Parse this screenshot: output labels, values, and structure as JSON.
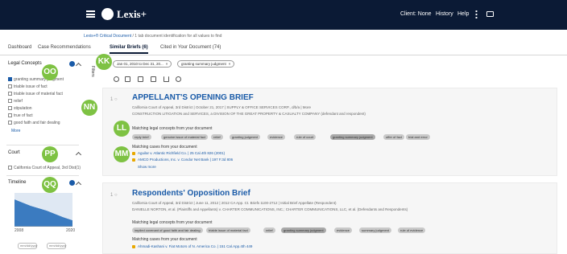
{
  "topbar": {
    "brand": "Lexis+",
    "links": [
      "Client: None",
      "History",
      "Help"
    ]
  },
  "breadcrumb": {
    "root": "Lexis+® Critical Document",
    "rest": "/ 1 tab document identification for all values to find"
  },
  "tabs": [
    {
      "label": "Dashboard",
      "active": false
    },
    {
      "label": "Case Recommendations",
      "active": false
    },
    {
      "label": "Similar Briefs (6)",
      "active": true
    },
    {
      "label": "Cited in Your Document (74)",
      "active": false
    }
  ],
  "sidebar": {
    "legal_concepts": {
      "title": "Legal Concepts",
      "options": [
        {
          "label": "granting summary judgment",
          "checked": true
        },
        {
          "label": "triable issue of fact",
          "checked": false
        },
        {
          "label": "triable issue of material fact",
          "checked": false
        },
        {
          "label": "relief",
          "checked": false
        },
        {
          "label": "stipulation",
          "checked": false
        },
        {
          "label": "true of fact",
          "checked": false
        },
        {
          "label": "good faith and fair dealing",
          "checked": false
        }
      ],
      "more": "More"
    },
    "court": {
      "title": "Court",
      "options": [
        {
          "label": "California Court of Appeal, 3rd Dist(1)",
          "checked": false
        }
      ]
    },
    "timeline": {
      "title": "Timeline",
      "x_start": "2008",
      "x_end": "2020",
      "from": "mm/dd/yyyy",
      "to": "mm/dd/yyyy"
    }
  },
  "filters_label": "Filters",
  "chips": [
    {
      "label": "Jan 01, 2010 to Dec 31, 20..."
    },
    {
      "label": "granting summary judgment"
    }
  ],
  "markers": [
    "KK",
    "OO",
    "NN",
    "LL",
    "MM",
    "PP",
    "QQ"
  ],
  "results": [
    {
      "num": "1 ○",
      "title": "APPELLANT'S OPENING BRIEF",
      "meta1": "California Court of Appeal, 3rd District  |  October 21, 2017  |  SUPPLY & OFFICE SERVICES CORP., d/b/a  |  More",
      "meta2": "CONSTRUCTION LITIGATION and SERVICES, a DIVISION OF THE GREAT PROPERTY & CASUALTY COMPANY (defendant and respondent)",
      "concepts_title": "Matching legal concepts from your document",
      "concepts": [
        {
          "label": "reply brief",
          "hl": false
        },
        {
          "label": "genuine issue of material fact",
          "hl": false
        },
        {
          "label": "relief",
          "hl": false
        },
        {
          "label": "granting judgment",
          "hl": false
        },
        {
          "label": "evidence",
          "hl": false
        },
        {
          "label": "rule of court",
          "hl": false
        },
        {
          "label": "granting summary judgment",
          "hl": true
        },
        {
          "label": "offer of fact",
          "hl": false
        },
        {
          "label": "trial and error",
          "hl": false
        }
      ],
      "cases_title": "Matching cases from your document",
      "cases": [
        "Aguilar v. Atlantic Richfield Co.  |  25 Cal.4th 826 (2001)",
        "AMCO Productions, Inc. v. Condor Net Bank  |  197 F.3d 806"
      ],
      "show_more": "Show more"
    },
    {
      "num": "1 ○",
      "title": "Respondents' Opposition Brief",
      "meta1": "California Court of Appeal, 3rd District  |  June 11, 2012  |  2012 CA App. Ct. Briefs 1100-2712  |  Initial Brief Appellate (Respondent)",
      "meta2": "DANIELLE NORTON, et al. (Plaintiffs and Appellants) v. CHARTER COMMUNICATIONS, INC.; CHARTER COMMUNICATIONS, LLC, et al. (Defendants and Respondents)",
      "concepts_title": "Matching legal concepts from your document",
      "concepts": [
        {
          "label": "implied covenant of good faith and fair dealing",
          "hl": false
        },
        {
          "label": "triable issue of material fact",
          "hl": false
        },
        {
          "label": "relief",
          "hl": false
        },
        {
          "label": "granting summary judgment",
          "hl": true
        },
        {
          "label": "evidence",
          "hl": false
        },
        {
          "label": "summary judgment",
          "hl": false
        },
        {
          "label": "rule of evidence",
          "hl": false
        }
      ],
      "cases_title": "Matching cases from your document",
      "cases": [
        "Ahmadi-Kashani v. Fiat Motors of N. America Co.  |  151 Cal.App.4th 449"
      ]
    }
  ],
  "colors": {
    "accent": "#1a5ba8",
    "nav": "#0b1a35",
    "marker": "#7ec243"
  }
}
